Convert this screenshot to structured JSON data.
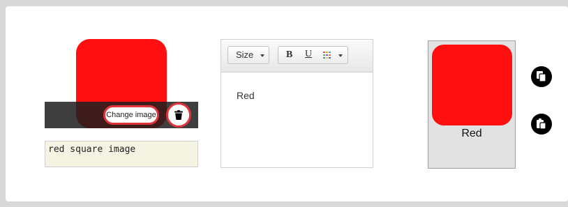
{
  "image_editor": {
    "change_label": "Change image",
    "caption_value": "red square image",
    "image_color": "#ff0f0f",
    "accent_color": "#e0343c",
    "delete_icon": "trash-icon"
  },
  "rich_text": {
    "size_label": "Size",
    "bold_label": "B",
    "underline_label": "U",
    "content": "Red"
  },
  "preview": {
    "label": "Red",
    "image_color": "#ff0f0f"
  },
  "actions": {
    "copy_icon": "copy-icon",
    "paste_icon": "paste-icon"
  }
}
